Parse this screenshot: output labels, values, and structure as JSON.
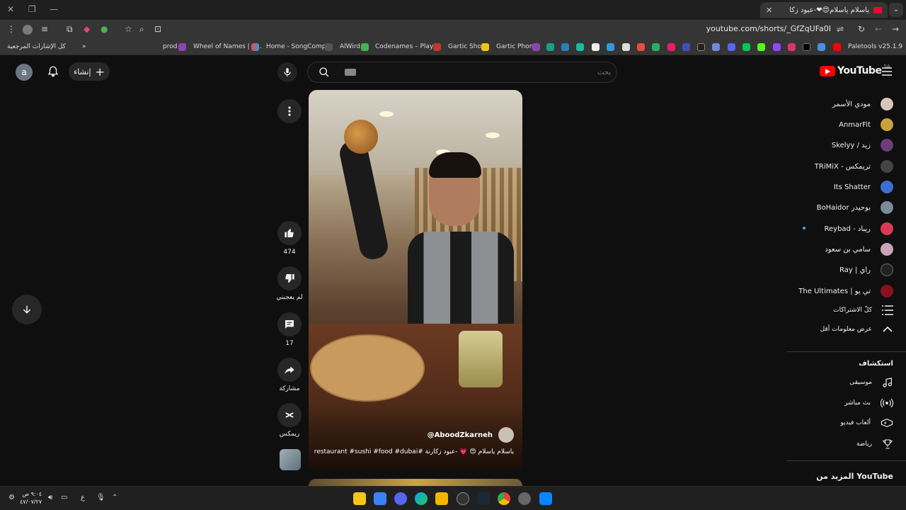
{
  "browser": {
    "tab_title": "ياسلام ياسلام😍❤-عبود زكا",
    "url": "youtube.com/shorts/_GfZqUFa0I",
    "bookmarks": [
      {
        "label": "كل الإشارات المرجعية"
      },
      {
        "label": "prod"
      },
      {
        "label": "Wheel of Names | R..."
      },
      {
        "label": "Home - SongComp..."
      },
      {
        "label": "AlWird"
      },
      {
        "label": "Codenames – Play..."
      },
      {
        "label": "Gartic Show"
      },
      {
        "label": "Gartic Phone"
      },
      {
        "label": "Paletools v25.1.9"
      }
    ]
  },
  "header": {
    "avatar_letter": "a",
    "create_label": "إنشاء",
    "search_placeholder": "بحث",
    "logo_text": "YouTube",
    "region": "SA"
  },
  "short": {
    "channel": "@AboodZkarneh",
    "title": "ياسلام ياسلام 😍 💗 -عبود زكارنة #restaurant #sushi #food #dubai"
  },
  "actions": {
    "like_count": "474",
    "dislike_label": "لم يعجبني",
    "comments_count": "17",
    "share_label": "مشاركة",
    "remix_label": "ريمكس"
  },
  "sidebar": {
    "subscriptions": [
      {
        "name": "مودي الأسمر",
        "color": "#d9c6b7"
      },
      {
        "name": "AnmarFit",
        "color": "#c9a23b"
      },
      {
        "name": "Skelyy / زيد",
        "color": "#6b3d7a"
      },
      {
        "name": "TRiMiX - تريمكس",
        "color": "#444"
      },
      {
        "name": "Its Shatter",
        "color": "#3b6fd4"
      },
      {
        "name": "BoHaidor بوحيدر",
        "color": "#7a8a96"
      },
      {
        "name": "Reybad - ريباد",
        "color": "#d83a52"
      },
      {
        "name": "سامي بن سعود",
        "color": "#c8a6b8"
      },
      {
        "name": "Ray | راي",
        "color": "#222"
      },
      {
        "name": "The Ultimates | تي يو",
        "color": "#8a1020"
      }
    ],
    "all_subscriptions": "كلّ الاشتراكات",
    "show_less": "عرض معلومات أقل",
    "explore_title": "استكشاف",
    "explore": [
      {
        "label": "موسيقى"
      },
      {
        "label": "بث مباشر"
      },
      {
        "label": "ألعاب فيديو"
      },
      {
        "label": "رياضة"
      }
    ],
    "more_from_youtube": "المزيد من YouTube"
  },
  "taskbar": {
    "time": "٩:٠٤ ص",
    "date": "٤٧/٠٧/٢٧",
    "lang": "ع"
  }
}
